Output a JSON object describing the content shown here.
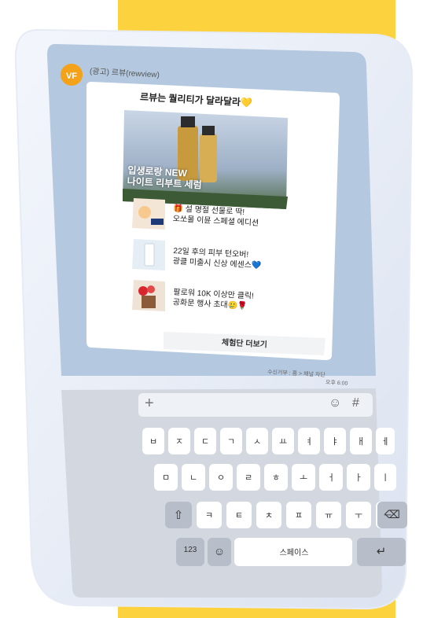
{
  "channel": {
    "sender_name": "(광고) 르뷰(rewview)"
  },
  "message": {
    "title": "르뷰는 퀄리티가 달라달라💛",
    "hero_text": "입생로랑 NEW\n나이트 리부트 세럼",
    "items": [
      {
        "text": "🎁 설 명절 선물로 딱!\n오쏘몰 이뮨 스페셜 에디션"
      },
      {
        "text": "22일 후의 피부 턴오버!\n광클 미출시 신상 에센스💙"
      },
      {
        "text": "팔로워 10K 이상만 클릭!\n공화문 행사 초대🥲🌹"
      }
    ],
    "more_button": "체험단 더보기",
    "unsubscribe": "수신거부 : 홈 > 채널 차단",
    "time": "오후 6:00"
  },
  "input_bar": {
    "plus_icon": "plus-icon",
    "emoji_icon": "smiley-icon",
    "hash_icon": "hash-icon"
  },
  "keyboard": {
    "row1": [
      "ㅂ",
      "ㅈ",
      "ㄷ",
      "ㄱ",
      "ㅅ",
      "ㅛ",
      "ㅕ",
      "ㅑ",
      "ㅐ",
      "ㅔ"
    ],
    "row2": [
      "ㅁ",
      "ㄴ",
      "ㅇ",
      "ㄹ",
      "ㅎ",
      "ㅗ",
      "ㅓ",
      "ㅏ",
      "ㅣ"
    ],
    "row3": [
      "ㅋ",
      "ㅌ",
      "ㅊ",
      "ㅍ",
      "ㅠ",
      "ㅜ",
      "ㅡ"
    ],
    "numbers_key": "123",
    "space_key": "스페이스",
    "shift_icon": "shift-icon",
    "backspace_icon": "backspace-icon",
    "emoji_key_icon": "emoji-icon",
    "return_icon": "return-icon"
  },
  "colors": {
    "yellow": "#FDD23F",
    "chat_bg": "#B4C8DF",
    "keyboard_bg": "#D3D7E0",
    "key_bg": "#FFFFFF",
    "heart_blue": "#2F6FD6"
  }
}
